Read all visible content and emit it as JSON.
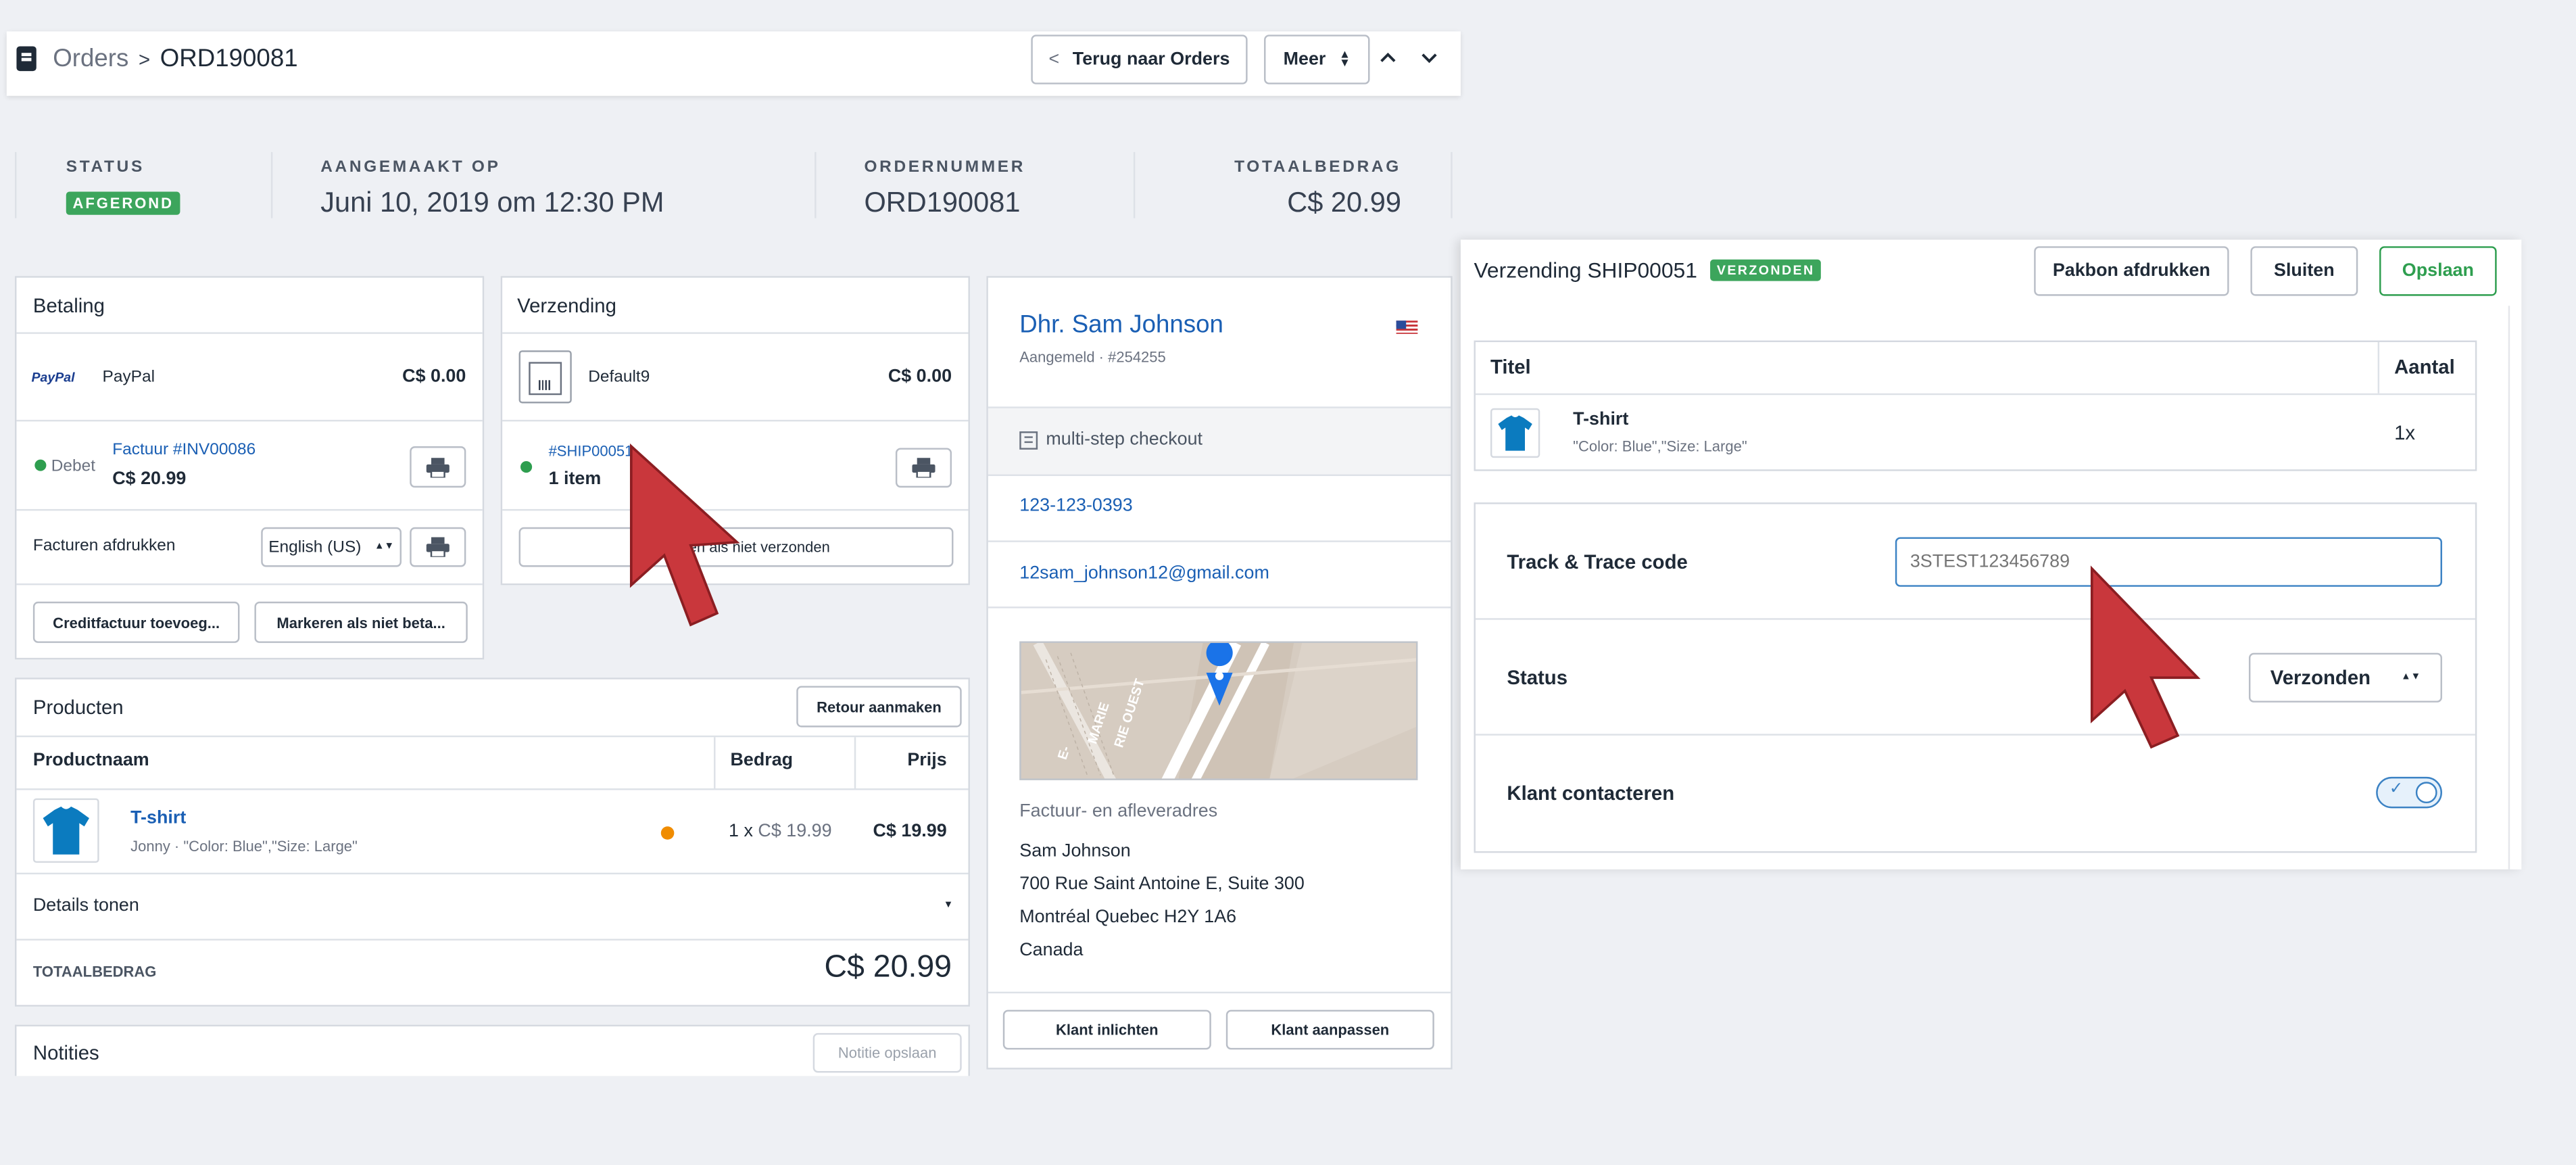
{
  "breadcrumb": {
    "parent": "Orders",
    "separator": ">",
    "current": "ORD190081"
  },
  "topbar": {
    "back_label": "Terug naar Orders",
    "back_chevron": "<",
    "more_label": "Meer"
  },
  "summary": {
    "status_label": "STATUS",
    "status_value": "AFGEROND",
    "created_label": "AANGEMAAKT OP",
    "created_value": "Juni 10, 2019 om 12:30 PM",
    "order_label": "ORDERNUMMER",
    "order_value": "ORD190081",
    "total_label": "TOTAALBEDRAG",
    "total_value": "C$ 20.99"
  },
  "payment": {
    "title": "Betaling",
    "method_logo": "PayPal",
    "method": "PayPal",
    "amount": "C$ 0.00",
    "debit_label": "Debet",
    "invoice_link": "Factuur #INV00086",
    "invoice_amount": "C$ 20.99",
    "print_label": "Facturen afdrukken",
    "language": "English (US)",
    "credit_button": "Creditfactuur toevoeg...",
    "unpaid_button": "Markeren als niet beta..."
  },
  "shipping": {
    "title": "Verzending",
    "method": "Default9",
    "amount": "C$ 0.00",
    "ship_link": "#SHIP00051",
    "items": "1 item",
    "not_ship_button": "Markeren als niet verzonden"
  },
  "customer": {
    "name": "Dhr. Sam Johnson",
    "meta": "Aangemeld · #254255",
    "checkout": "multi-step checkout",
    "phone": "123-123-0393",
    "email": "12sam_johnson12@gmail.com",
    "address_title": "Factuur- en afleveradres",
    "address_lines": [
      "Sam Johnson",
      "700 Rue Saint Antoine E, Suite 300",
      "Montréal Quebec H2Y 1A6",
      "Canada"
    ],
    "notify_button": "Klant inlichten",
    "edit_button": "Klant aanpassen",
    "map_label_1": "MARIE",
    "map_label_2": "RIE OUEST",
    "map_label_3": "E-"
  },
  "products": {
    "title": "Producten",
    "return_button": "Retour aanmaken",
    "col_name": "Productnaam",
    "col_amount": "Bedrag",
    "col_price": "Prijs",
    "item_name": "T-shirt",
    "item_meta": "Jonny · \"Color: Blue\",\"Size: Large\"",
    "item_qty": "1 x",
    "item_unit": "C$ 19.99",
    "item_price": "C$ 19.99",
    "details_label": "Details tonen",
    "total_label": "TOTAALBEDRAG",
    "total_value": "C$ 20.99"
  },
  "notes": {
    "title": "Notities",
    "save_button": "Notitie opslaan"
  },
  "shipment_panel": {
    "title": "Verzending SHIP00051",
    "badge": "VERZONDEN",
    "print_button": "Pakbon afdrukken",
    "close_button": "Sluiten",
    "save_button": "Opslaan",
    "col_title": "Titel",
    "col_qty": "Aantal",
    "item_name": "T-shirt",
    "item_meta": "\"Color: Blue\",\"Size: Large\"",
    "item_qty": "1x",
    "track_label": "Track & Trace code",
    "track_placeholder": "3STEST123456789",
    "status_label": "Status",
    "status_value": "Verzonden",
    "contact_label": "Klant contacteren",
    "contact_enabled": true
  },
  "colors": {
    "accent_green": "#2e9e4f",
    "link_blue": "#1a5fb4",
    "cursor_red": "#c9373c",
    "shirt_blue": "#0b7bbf",
    "status_orange": "#f08c00"
  }
}
